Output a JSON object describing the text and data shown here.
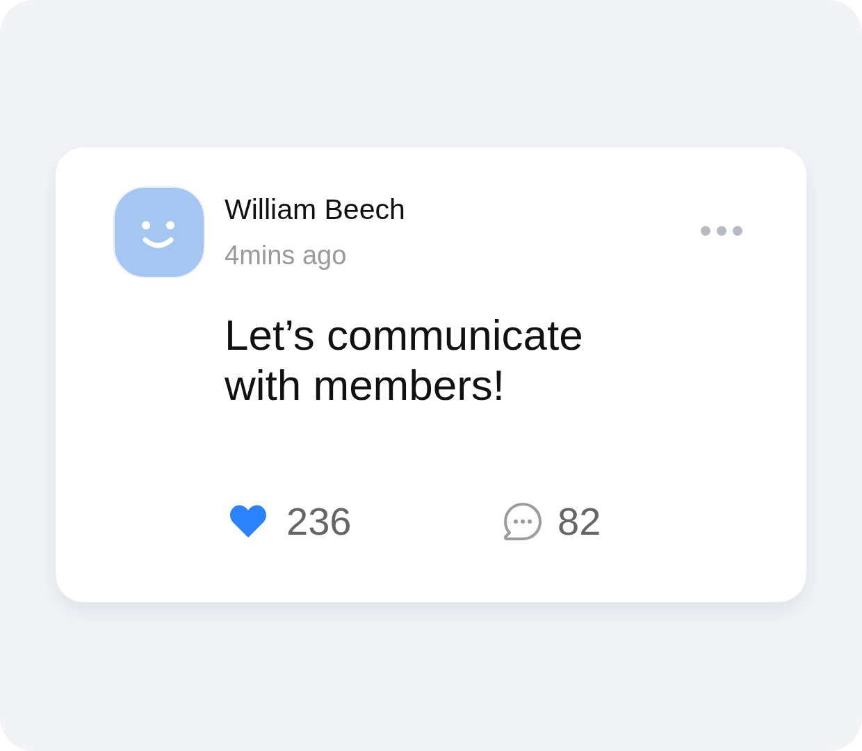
{
  "post": {
    "author": "William Beech",
    "time": "4mins ago",
    "message": "Let’s communicate with members!",
    "likes": {
      "count": "236",
      "liked": true
    },
    "comments": {
      "count": "82"
    }
  }
}
